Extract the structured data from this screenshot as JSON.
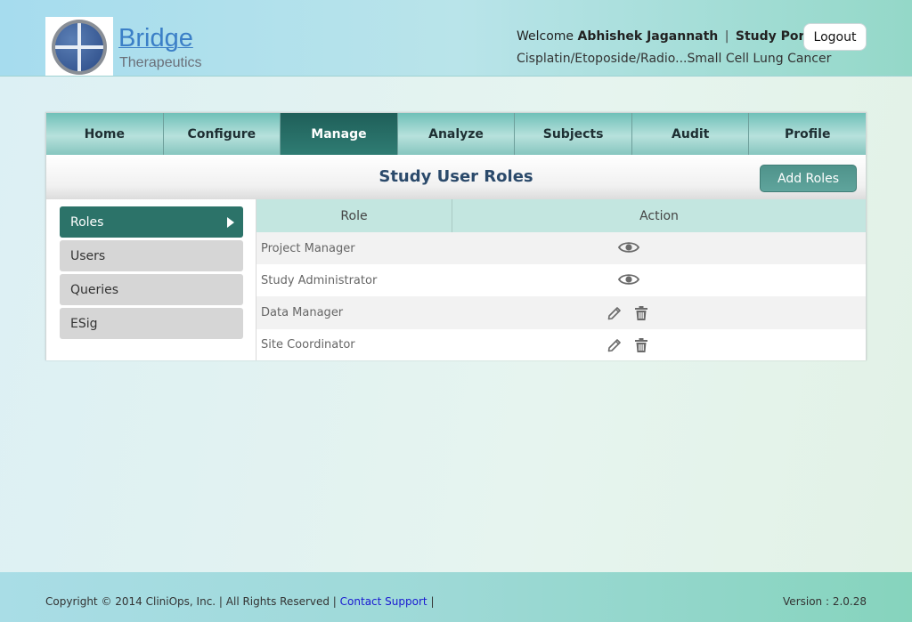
{
  "header": {
    "brand_name": "Bridge",
    "brand_sub": "Therapeutics",
    "welcome_prefix": "Welcome",
    "user_name": "Abhishek Jagannath",
    "separator": "|",
    "portal_label": "Study Portal",
    "study_name": "Cisplatin/Etoposide/Radio...Small Cell Lung Cancer",
    "logout_label": "Logout"
  },
  "nav": {
    "tabs": [
      {
        "label": "Home"
      },
      {
        "label": "Configure"
      },
      {
        "label": "Manage"
      },
      {
        "label": "Analyze"
      },
      {
        "label": "Subjects"
      },
      {
        "label": "Audit"
      },
      {
        "label": "Profile"
      }
    ],
    "active_tab": "Manage"
  },
  "main": {
    "title": "Study User Roles",
    "add_button_label": "Add Roles"
  },
  "sidebar": {
    "items": [
      {
        "label": "Roles"
      },
      {
        "label": "Users"
      },
      {
        "label": "Queries"
      },
      {
        "label": "ESig"
      }
    ],
    "active_item": "Roles"
  },
  "table": {
    "headers": {
      "role": "Role",
      "action": "Action"
    },
    "rows": [
      {
        "role": "Project Manager",
        "actions": [
          "view-icon"
        ]
      },
      {
        "role": "Study Administrator",
        "actions": [
          "view-icon"
        ]
      },
      {
        "role": "Data Manager",
        "actions": [
          "edit-icon",
          "delete-icon"
        ]
      },
      {
        "role": "Site Coordinator",
        "actions": [
          "edit-icon",
          "delete-icon"
        ]
      }
    ]
  },
  "footer": {
    "copyright": "Copyright © 2014 CliniOps, Inc. | All Rights Reserved |",
    "contact_link": "Contact Support",
    "trailing_sep": "|",
    "version": "Version : 2.0.28"
  },
  "colors": {
    "accent": "#2c7369",
    "title": "#2b4a6b",
    "table_header": "#c3e6e0"
  }
}
